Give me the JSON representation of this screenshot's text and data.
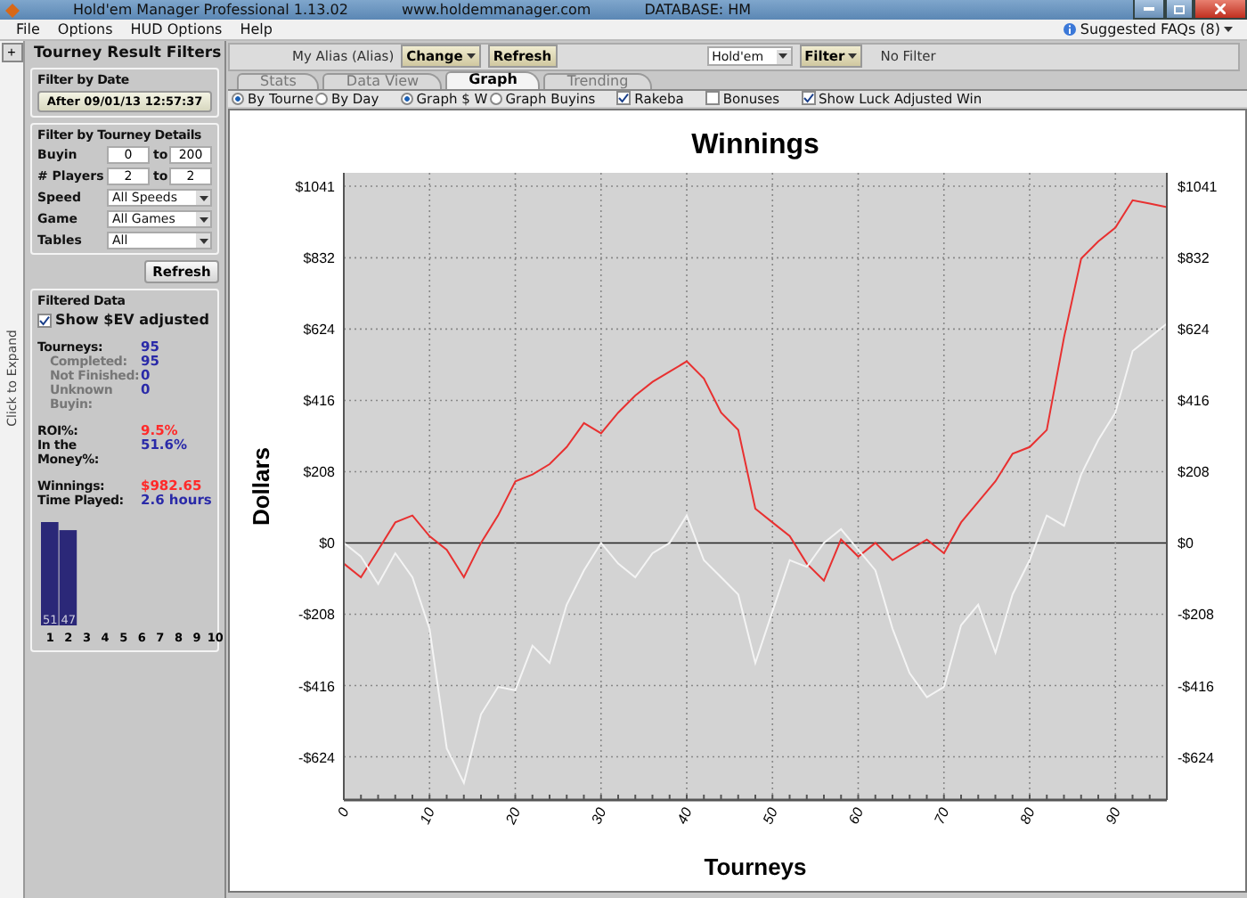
{
  "window": {
    "title": "Hold'em Manager Professional 1.13.02",
    "website": "www.holdemmanager.com",
    "database": "DATABASE: HM"
  },
  "menu": [
    "File",
    "Options",
    "HUD Options",
    "Help"
  ],
  "faqs": "Suggested FAQs (8)",
  "expand_strip": {
    "button": "+",
    "label": "Click to Expand"
  },
  "sidebar": {
    "title": "Tourney Result Filters",
    "date_filter": {
      "title": "Filter by Date",
      "button": "After 09/01/13 12:57:37"
    },
    "details": {
      "title": "Filter by Tourney Details",
      "ranges": [
        {
          "label": "Buyin",
          "from": "0",
          "to_label": "to",
          "to": "200"
        },
        {
          "label": "# Players",
          "from": "2",
          "to_label": "to",
          "to": "2"
        }
      ],
      "selects": [
        {
          "label": "Speed",
          "value": "All Speeds"
        },
        {
          "label": "Game",
          "value": "All Games"
        },
        {
          "label": "Tables",
          "value": "All"
        }
      ],
      "button": "Refresh"
    },
    "filtered": {
      "title": "Filtered Data",
      "ev_checkbox": {
        "label": "Show $EV adjusted",
        "checked": true
      },
      "stat_groups": [
        {
          "items": [
            {
              "label": "Tourneys:",
              "value": "95",
              "sub": false,
              "color": "#2a2aa8"
            },
            {
              "label": "Completed:",
              "value": "95",
              "sub": true,
              "color": "#2a2aa8"
            },
            {
              "label": "Not Finished:",
              "value": "0",
              "sub": true,
              "color": "#2a2aa8"
            },
            {
              "label": "Unknown Buyin:",
              "value": "0",
              "sub": true,
              "color": "#2a2aa8"
            }
          ]
        },
        {
          "items": [
            {
              "label": "ROI%:",
              "value": "9.5%",
              "sub": false,
              "color": "#ff2a2a"
            },
            {
              "label": "In the Money%:",
              "value": "51.6%",
              "sub": false,
              "color": "#2a2aa8"
            }
          ]
        },
        {
          "items": [
            {
              "label": "Winnings:",
              "value": "$982.65",
              "sub": false,
              "color": "#ff2a2a"
            },
            {
              "label": "Time Played:",
              "value": "2.6 hours",
              "sub": false,
              "color": "#2a2aa8"
            }
          ]
        }
      ],
      "chart_data": {
        "type": "bar",
        "categories": [
          "1",
          "2",
          "3",
          "4",
          "5",
          "6",
          "7",
          "8",
          "9",
          "10"
        ],
        "series": [
          {
            "color": "#2b2878",
            "values": [
              51,
              47,
              null,
              null,
              null,
              null,
              null,
              null,
              null,
              null
            ]
          }
        ],
        "data_labels": true
      }
    }
  },
  "toolbar": {
    "alias": "My Alias (Alias)",
    "change_button": "Change",
    "refresh_button": "Refresh",
    "game": "Hold'em",
    "filter_button": "Filter",
    "filter_status": "No Filter"
  },
  "tabs": [
    {
      "label": "Stats",
      "selected": false
    },
    {
      "label": "Data View",
      "selected": false
    },
    {
      "label": "Graph",
      "selected": true
    },
    {
      "label": "Trending",
      "selected": false
    }
  ],
  "options": {
    "radio_groups": [
      {
        "items": [
          {
            "label": "By Tourne",
            "selected": true
          },
          {
            "label": "By Day",
            "selected": false
          }
        ]
      },
      {
        "items": [
          {
            "label": "Graph $ W",
            "selected": true
          },
          {
            "label": "Graph Buyins",
            "selected": false
          }
        ]
      }
    ],
    "checkboxes": [
      {
        "label": "Rakeba",
        "checked": true
      },
      {
        "label": "Bonuses",
        "checked": false
      },
      {
        "label": "Show Luck Adjusted Win",
        "checked": true
      }
    ]
  },
  "chart_data": {
    "type": "line",
    "title": "Winnings",
    "xlabel": "Tourneys",
    "ylabel": "Dollars",
    "x": [
      0,
      2,
      4,
      6,
      8,
      10,
      12,
      14,
      16,
      18,
      20,
      22,
      24,
      26,
      28,
      30,
      32,
      34,
      36,
      38,
      40,
      42,
      44,
      46,
      48,
      50,
      52,
      54,
      56,
      58,
      60,
      62,
      64,
      66,
      68,
      70,
      72,
      74,
      76,
      78,
      80,
      82,
      84,
      86,
      88,
      90,
      92,
      94,
      96
    ],
    "series": [
      {
        "color": "#e83030",
        "values": [
          -60,
          -100,
          -20,
          60,
          80,
          20,
          -20,
          -100,
          0,
          80,
          180,
          200,
          230,
          280,
          350,
          320,
          380,
          430,
          470,
          500,
          530,
          480,
          380,
          330,
          100,
          60,
          20,
          -60,
          -110,
          10,
          -40,
          0,
          -50,
          -20,
          10,
          -30,
          60,
          120,
          180,
          260,
          280,
          330,
          600,
          830,
          880,
          920,
          1000,
          990,
          980
        ]
      },
      {
        "color": "#f4f4f4",
        "values": [
          0,
          -40,
          -120,
          -30,
          -100,
          -250,
          -600,
          -700,
          -500,
          -420,
          -430,
          -300,
          -350,
          -180,
          -80,
          0,
          -60,
          -100,
          -30,
          0,
          80,
          -50,
          -100,
          -150,
          -350,
          -200,
          -50,
          -70,
          0,
          40,
          -20,
          -80,
          -250,
          -380,
          -450,
          -420,
          -240,
          -180,
          -320,
          -150,
          -50,
          80,
          50,
          200,
          300,
          380,
          560,
          600,
          640
        ]
      }
    ],
    "xlim": [
      0,
      96
    ],
    "ylim": [
      -750,
      1080
    ],
    "grid": true,
    "xticks": [
      0,
      10,
      20,
      30,
      40,
      50,
      60,
      70,
      80,
      90
    ],
    "yticks": [
      {
        "value": -624,
        "label": "-$624"
      },
      {
        "value": -416,
        "label": "-$416"
      },
      {
        "value": -208,
        "label": "-$208"
      },
      {
        "value": 0,
        "label": "$0"
      },
      {
        "value": 208,
        "label": "$208"
      },
      {
        "value": 416,
        "label": "$416"
      },
      {
        "value": 624,
        "label": "$624"
      },
      {
        "value": 832,
        "label": "$832"
      },
      {
        "value": 1041,
        "label": "$1041"
      }
    ]
  }
}
